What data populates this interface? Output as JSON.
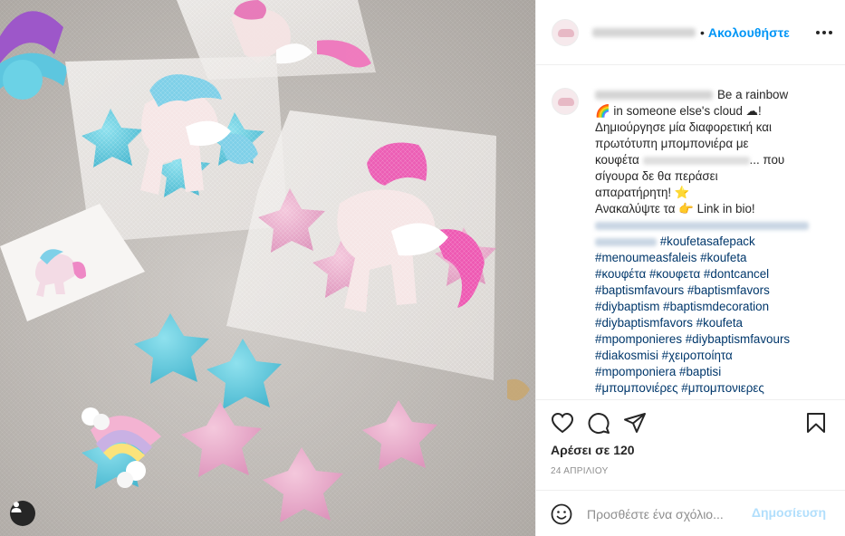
{
  "header": {
    "username": "",
    "separator": "•",
    "follow_label": "Ακολουθήστε"
  },
  "caption": {
    "text_1": "Be a rainbow",
    "text_2": "in someone else's cloud",
    "text_3": "!",
    "line_2": "Δημιούργησε μία διαφορετική και",
    "line_3": "πρωτότυπη μπομπονιέρα με",
    "line_4a": "κουφέτα",
    "line_4b": "... που",
    "line_5": "σίγουρα δε θα περάσει",
    "line_6": "απαρατήρητη!",
    "line_7a": "Ανακαλύψτε τα",
    "line_7b": "Link in bio!",
    "hashtag_lines": [
      "#koufetasafepack",
      "#menoumeasfaleis #koufeta",
      "#κουφέτα #κουφετα #dontcancel",
      "#baptismfavours #baptismfavors",
      "#diybaptism #baptismdecoration",
      "#diybaptismfavors #koufeta",
      "#mpomponieres #diybaptismfavours",
      "#diakosmisi #χειροποίητα",
      "#mpomponiera #baptisi",
      "#μπομπονιέρες #μπομπονιερες"
    ],
    "emoji": {
      "rainbow": "🌈",
      "cloud": "☁",
      "star": "⭐",
      "hand": "👉"
    }
  },
  "actions": {
    "likes_label": "Αρέσει σε 120",
    "date": "24 ΑΠΡΙΛΙΟΥ"
  },
  "comment": {
    "placeholder": "Προσθέστε ένα σχόλιο...",
    "post_label": "Δημοσίευση"
  },
  "colors": {
    "accent": "#0095f6",
    "hashtag": "#00376b",
    "muted": "#8e8e8e",
    "post_disabled": "#b2dffc"
  },
  "icons": [
    "heart-icon",
    "comment-icon",
    "share-icon",
    "bookmark-icon",
    "emoji-icon",
    "more-icon",
    "user-tag-icon"
  ]
}
